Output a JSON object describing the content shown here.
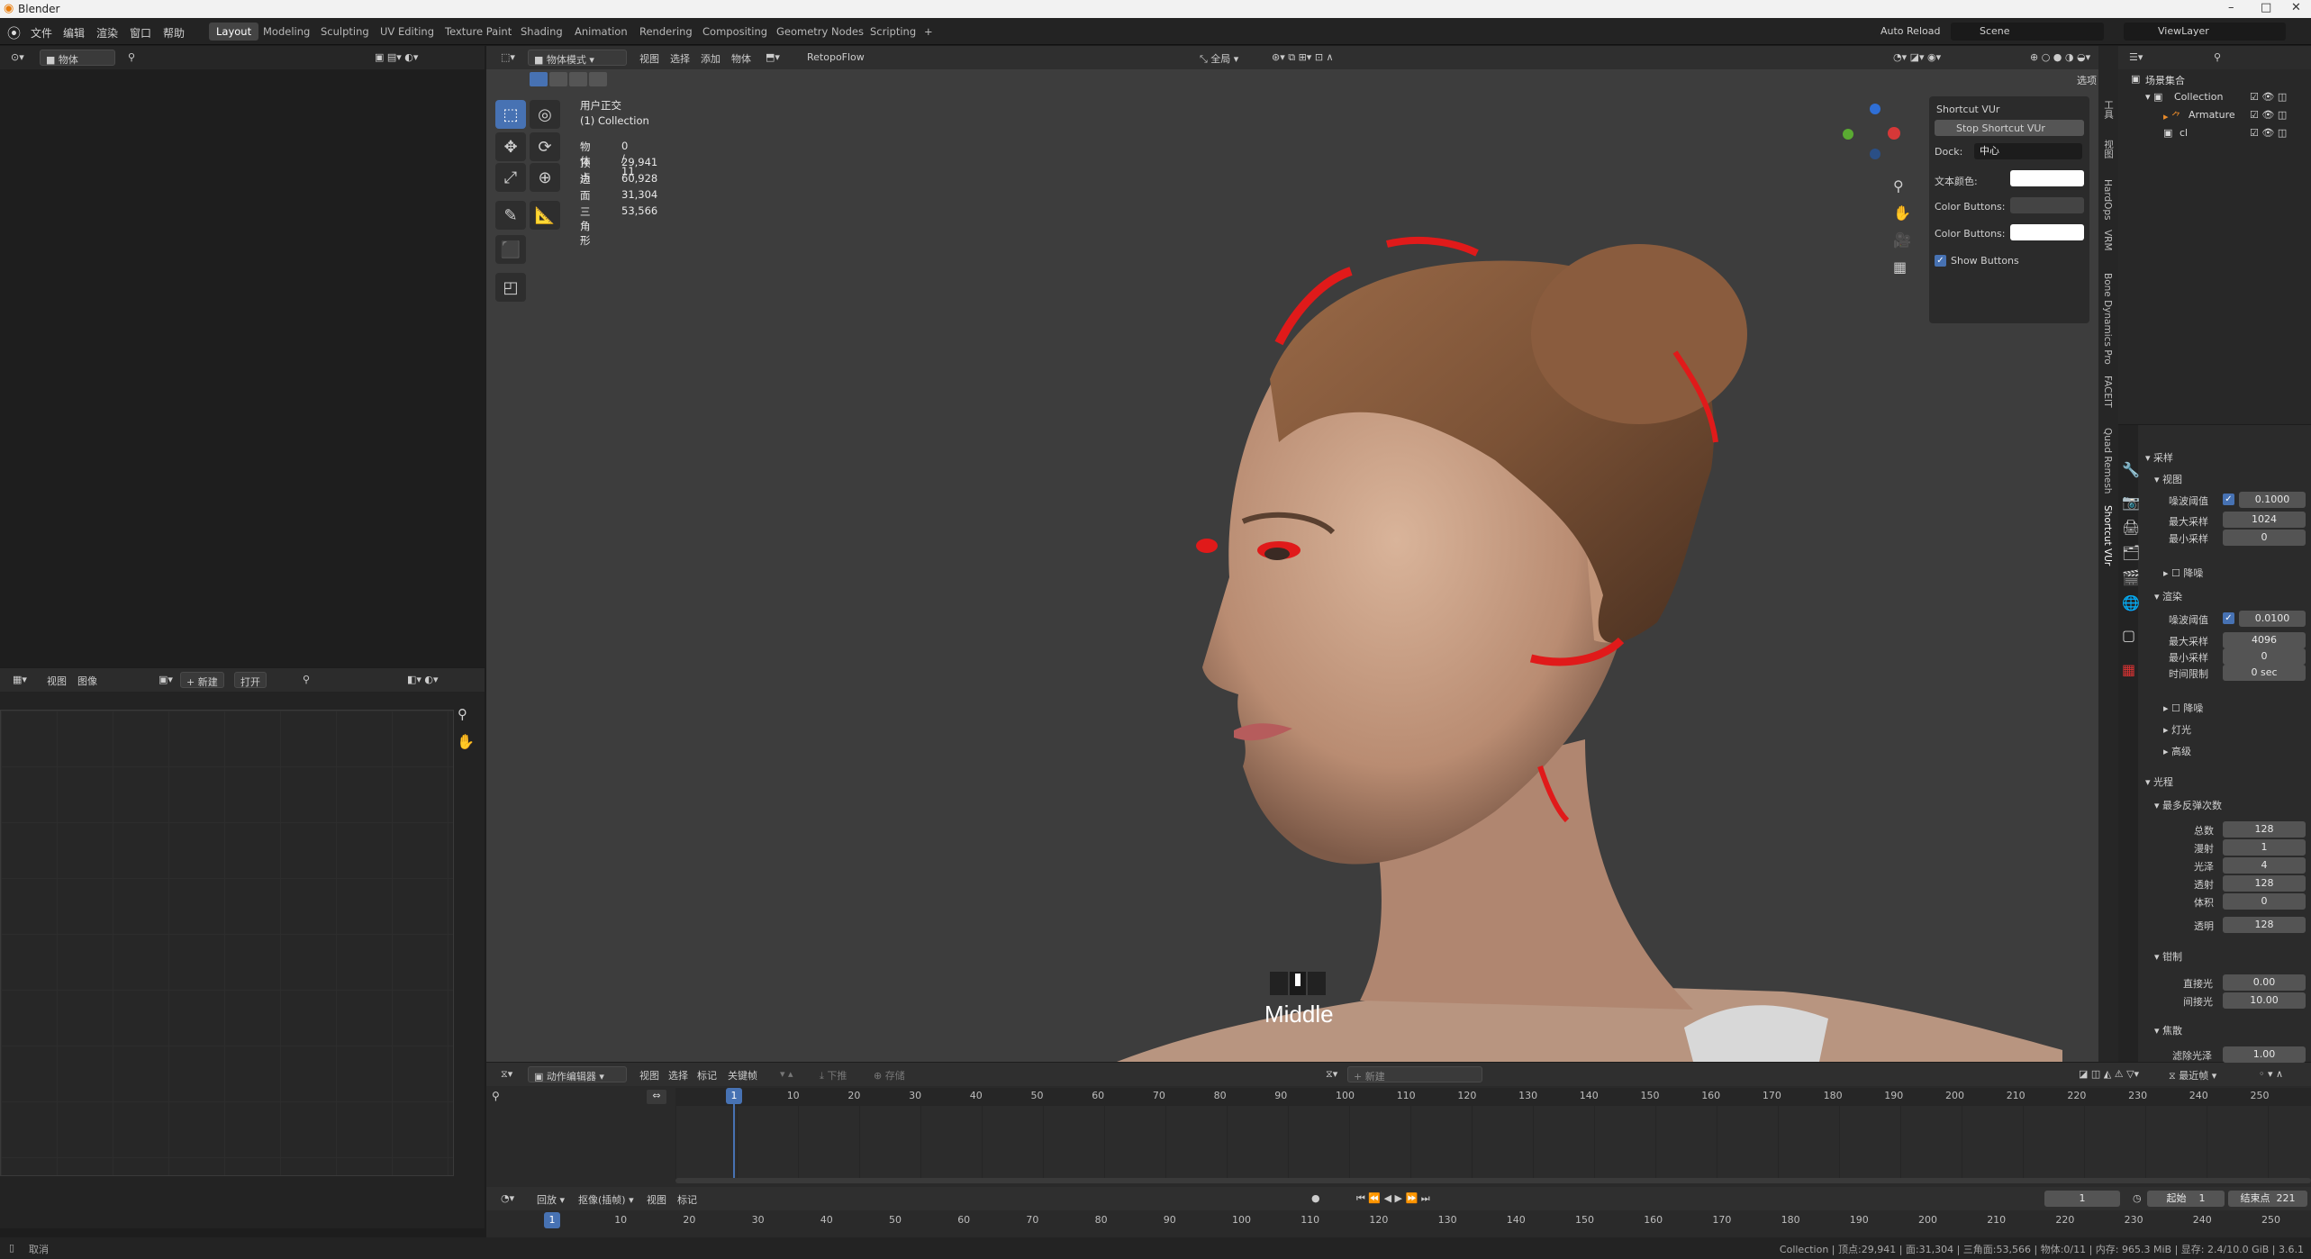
{
  "window": {
    "title": "Blender",
    "min": "–",
    "max": "□",
    "close": "✕"
  },
  "menus": [
    "文件",
    "编辑",
    "渲染",
    "窗口",
    "帮助"
  ],
  "workspaces": [
    "Layout",
    "Modeling",
    "Sculpting",
    "UV Editing",
    "Texture Paint",
    "Shading",
    "Animation",
    "Rendering",
    "Compositing",
    "Geometry Nodes",
    "Scripting",
    "+"
  ],
  "top_right": {
    "auto_reload": "Auto Reload",
    "scene": "Scene",
    "view_layer": "ViewLayer"
  },
  "left_top_header": {
    "mode": "物体"
  },
  "image_editor": {
    "menus": [
      "视图",
      "图像"
    ],
    "new": "+ 新建",
    "open": "打开"
  },
  "viewport_header": {
    "mode": "物体模式",
    "menus": [
      "视图",
      "选择",
      "添加",
      "物体"
    ],
    "addon": "RetopoFlow",
    "global": "全局",
    "options": "选项"
  },
  "viewport_info": {
    "view": "用户正交",
    "collection": "(1) Collection"
  },
  "stats": [
    {
      "label": "物体",
      "value": "0 / 11"
    },
    {
      "label": "顶点",
      "value": "29,941"
    },
    {
      "label": "边",
      "value": "60,928"
    },
    {
      "label": "面",
      "value": "31,304"
    },
    {
      "label": "三角形",
      "value": "53,566"
    }
  ],
  "overlay_text": "Middle",
  "shortcut_panel": {
    "title": "Shortcut VUr",
    "stop": "Stop Shortcut VUr",
    "dock_label": "Dock:",
    "dock_value": "中心",
    "text_color": "文本颜色:",
    "color_buttons_1": "Color Buttons:",
    "color_buttons_2": "Color Buttons:",
    "show_buttons": "Show Buttons"
  },
  "vertical_tabs": [
    "工具",
    "视图",
    "HardOps",
    "VRM",
    "Bone Dynamics Pro",
    "FACEIT",
    "Quad Remesh",
    "Shortcut VUr"
  ],
  "outliner": {
    "root": "场景集合",
    "items": [
      "Collection",
      "Armature",
      "cl"
    ]
  },
  "properties": {
    "sampling": "采样",
    "viewport": "视图",
    "noise_threshold": "噪波阈值",
    "viewport_noise_threshold": "0.1000",
    "max_samples": "最大采样",
    "viewport_max_samples": "1024",
    "min_samples": "最小采样",
    "viewport_min_samples": "0",
    "denoise": "降噪",
    "render": "渲染",
    "render_noise_threshold": "0.0100",
    "render_max_samples": "4096",
    "render_min_samples": "0",
    "time_limit": "时间限制",
    "time_limit_value": "0 sec",
    "denoise2": "降噪",
    "lights": "灯光",
    "advanced": "高级",
    "light_paths": "光程",
    "max_bounces": "最多反弹次数",
    "total": "总数",
    "total_v": "128",
    "diffuse": "漫射",
    "diffuse_v": "1",
    "glossy": "光泽",
    "glossy_v": "4",
    "transmission": "透射",
    "transmission_v": "128",
    "volume": "体积",
    "volume_v": "0",
    "transparent": "透明",
    "transparent_v": "128",
    "clamping": "钳制",
    "direct": "直接光",
    "direct_v": "0.00",
    "indirect": "间接光",
    "indirect_v": "10.00",
    "caustics": "焦散",
    "filter_glossy": "滤除光泽",
    "filter_glossy_v": "1.00"
  },
  "dopesheet": {
    "mode": "动作编辑器",
    "menus": [
      "视图",
      "选择",
      "标记",
      "关键帧"
    ],
    "push_down": "下推",
    "stash": "存储",
    "new": "新建",
    "frame_mode": "最近帧",
    "ticks": [
      "1",
      "10",
      "20",
      "30",
      "40",
      "50",
      "60",
      "70",
      "80",
      "90",
      "100",
      "110",
      "120",
      "130",
      "140",
      "150",
      "160",
      "170",
      "180",
      "190",
      "200",
      "210",
      "220",
      "230",
      "240",
      "250"
    ]
  },
  "timeline": {
    "playback": "回放",
    "keying": "抠像(插帧)",
    "view": "视图",
    "marker": "标记",
    "current_frame": "1",
    "start_label": "起始",
    "start": "1",
    "end_label": "结束点",
    "end": "221",
    "ticks": [
      "1",
      "10",
      "20",
      "30",
      "40",
      "50",
      "60",
      "70",
      "80",
      "90",
      "100",
      "110",
      "120",
      "130",
      "140",
      "150",
      "160",
      "170",
      "180",
      "190",
      "200",
      "210",
      "220",
      "230",
      "240",
      "250"
    ]
  },
  "statusbar": {
    "left": "取消",
    "right": "Collection | 顶点:29,941 | 面:31,304 | 三角面:53,566 | 物体:0/11 | 内存: 965.3 MiB | 显存: 2.4/10.0 GiB | 3.6.1"
  },
  "colors": {
    "accent": "#4772b3",
    "red_markup": "#e01a1a",
    "bg_viewport": "#3d3d3d"
  }
}
